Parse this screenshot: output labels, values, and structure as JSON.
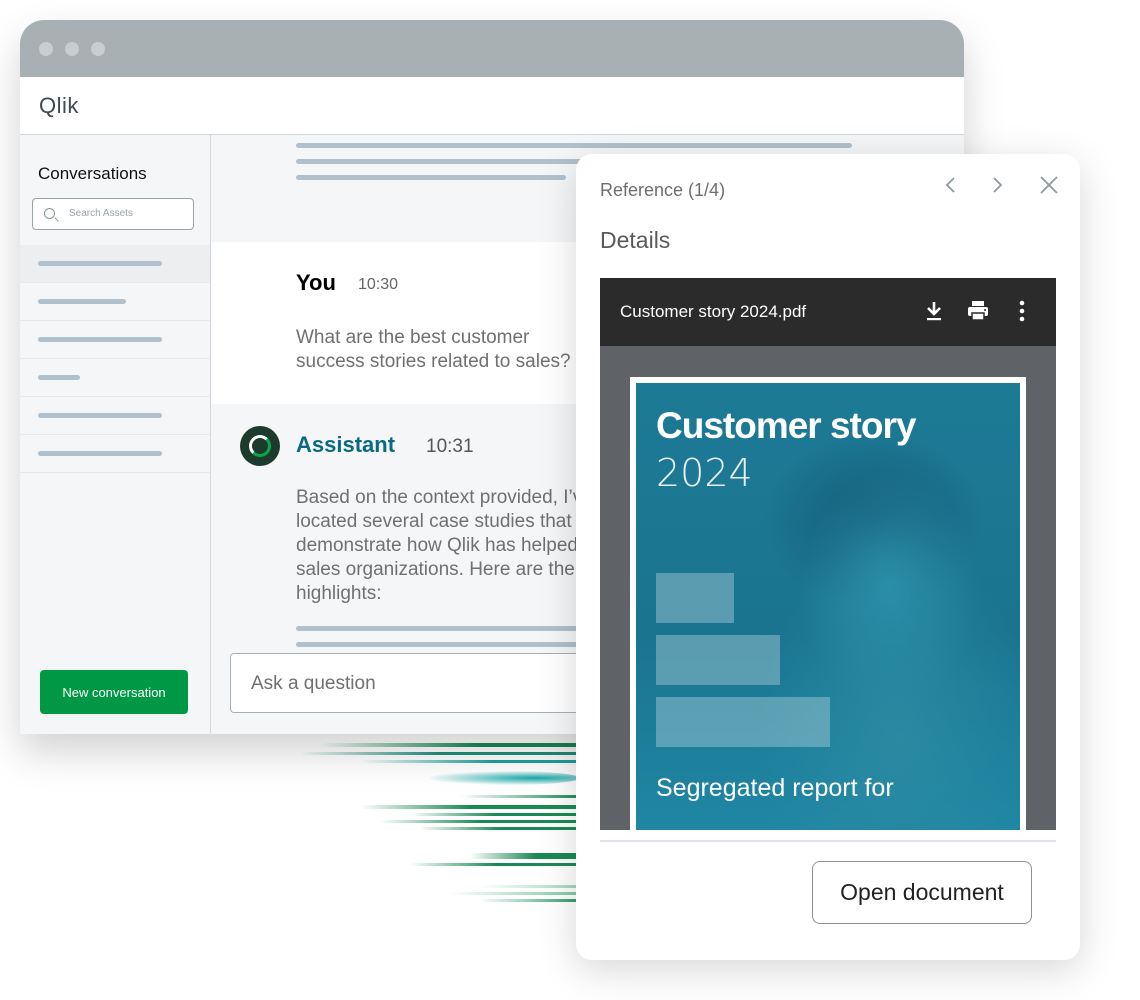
{
  "app": {
    "logo": "Qlik"
  },
  "sidebar": {
    "title": "Conversations",
    "search_placeholder": "Search Assets",
    "items_count": 6,
    "new_conversation_label": "New conversation"
  },
  "chat": {
    "user": {
      "name": "You",
      "time": "10:30",
      "message": "What are the best customer success stories related to sales?"
    },
    "assistant": {
      "name": "Assistant",
      "time": "10:31",
      "message": "Based on the context provided, I’ve located several case studies that demonstrate how Qlik has helped sales organizations. Here are the highlights:"
    },
    "input_placeholder": "Ask a question"
  },
  "reference": {
    "title": "Reference (1/4)",
    "section": "Details",
    "file_name": "Customer story 2024.pdf",
    "cover_title": "Customer story",
    "cover_year": "2024",
    "cover_subtitle": "Segregated report for",
    "open_button": "Open document"
  },
  "colors": {
    "brand_green": "#009845",
    "assistant_teal": "#0b6a82",
    "placeholder_bar": "#b0c0cc"
  }
}
